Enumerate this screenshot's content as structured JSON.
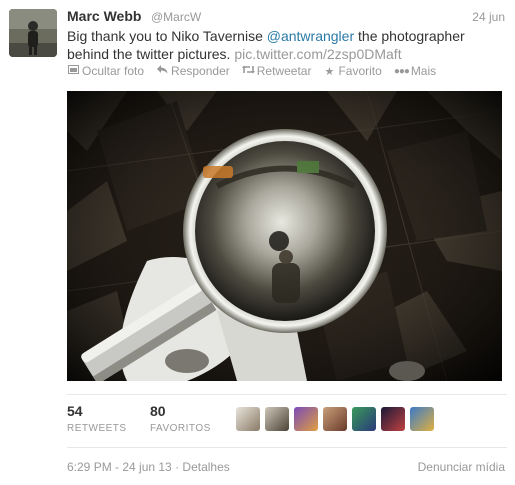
{
  "tweet": {
    "name": "Marc Webb",
    "handle": "@MarcW",
    "date": "24 jun",
    "text_part1": "Big thank you to Niko Tavernise ",
    "mention": "@antwrangler",
    "text_part2": " the photographer behind the twitter pictures. ",
    "pic_link": "pic.twitter.com/2zsp0DMaft"
  },
  "actions": [
    {
      "label": "Ocultar foto",
      "icon": "photo-icon"
    },
    {
      "label": "Responder",
      "icon": "reply-icon"
    },
    {
      "label": "Retweetar",
      "icon": "retweet-icon"
    },
    {
      "label": "Favorito",
      "icon": "star-icon"
    },
    {
      "label": "Mais",
      "icon": "more-icon"
    }
  ],
  "stats": {
    "retweets": {
      "count": "54",
      "label": "RETWEETS"
    },
    "favorites": {
      "count": "80",
      "label": "FAVORITOS"
    }
  },
  "footer": {
    "timestamp": "6:29 PM - 24 jun 13",
    "separator": "·",
    "details": "Detalhes",
    "report": "Denunciar mídia"
  },
  "colors": {
    "link": "#2a7aa8",
    "muted": "#999999",
    "text": "#333333"
  }
}
